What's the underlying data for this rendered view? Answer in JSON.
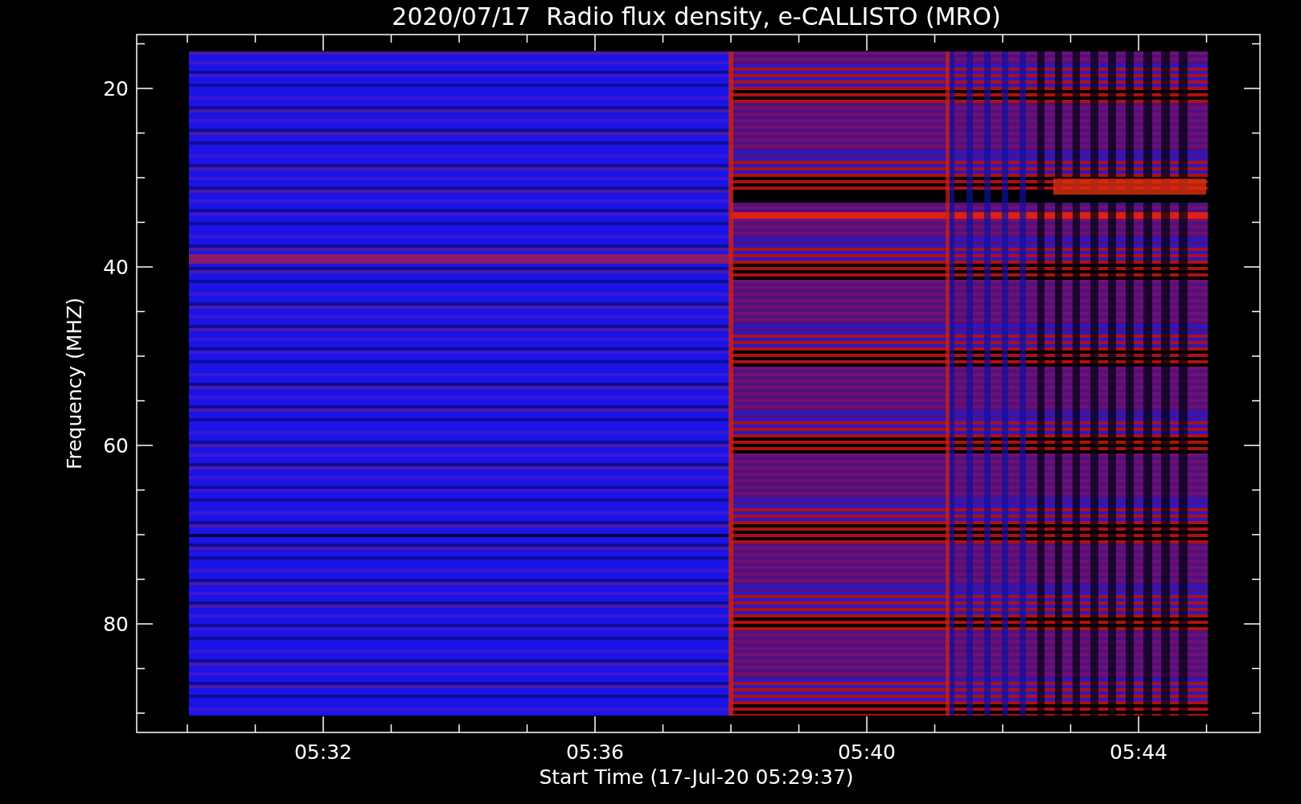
{
  "title": "2020/07/17  Radio flux density, e-CALLISTO (MRO)",
  "y_axis": {
    "label": "Frequency (MHZ)",
    "ticks": [
      "20",
      "40",
      "60",
      "80"
    ]
  },
  "x_axis": {
    "label": "Start Time (17-Jul-20 05:29:37)",
    "ticks": [
      "05:32",
      "05:36",
      "05:40",
      "05:44"
    ]
  }
}
